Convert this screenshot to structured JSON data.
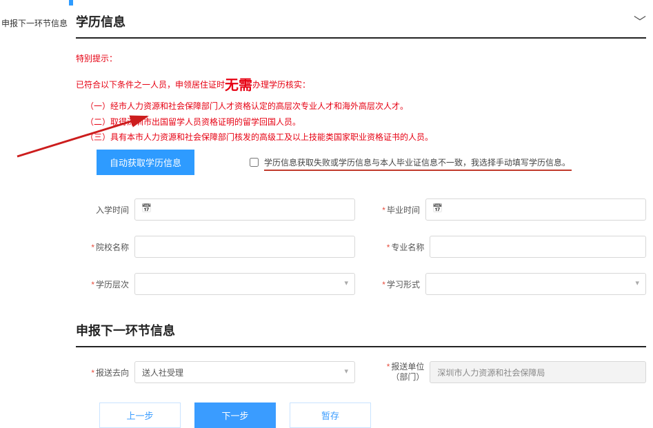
{
  "nav": {
    "label": "申报下一环节信息"
  },
  "section1": {
    "title": "学历信息",
    "notice": {
      "l1_a": "特别提示：",
      "l2_a": "已符合以下条件之一人员，申领居住证时",
      "l2_big": "无需",
      "l2_b": "办理学历核实：",
      "li1": "（一）经市人力资源和社会保障部门人才资格认定的高层次专业人才和海外高层次人才。",
      "li2": "（二）取得深圳市出国留学人员资格证明的留学回国人员。",
      "li3": "（三）具有本市人力资源和社会保障部门核发的高级工及以上技能类国家职业资格证书的人员。"
    },
    "autoBtn": "自动获取学历信息",
    "checkboxLabel": "学历信息获取失败或学历信息与本人毕业证信息不一致，我选择手动填写学历信息。",
    "fields": {
      "enrollDate": "入学时间",
      "gradDate": "毕业时间",
      "school": "院校名称",
      "major": "专业名称",
      "level": "学历层次",
      "form": "学习形式"
    }
  },
  "section2": {
    "title": "申报下一环节信息",
    "fields": {
      "dest": "报送去向",
      "destValue": "送人社受理",
      "unit": "报送单位（部门）",
      "unitValue": "深圳市人力资源和社会保障局"
    }
  },
  "buttons": {
    "prev": "上一步",
    "next": "下一步",
    "save": "暂存"
  }
}
